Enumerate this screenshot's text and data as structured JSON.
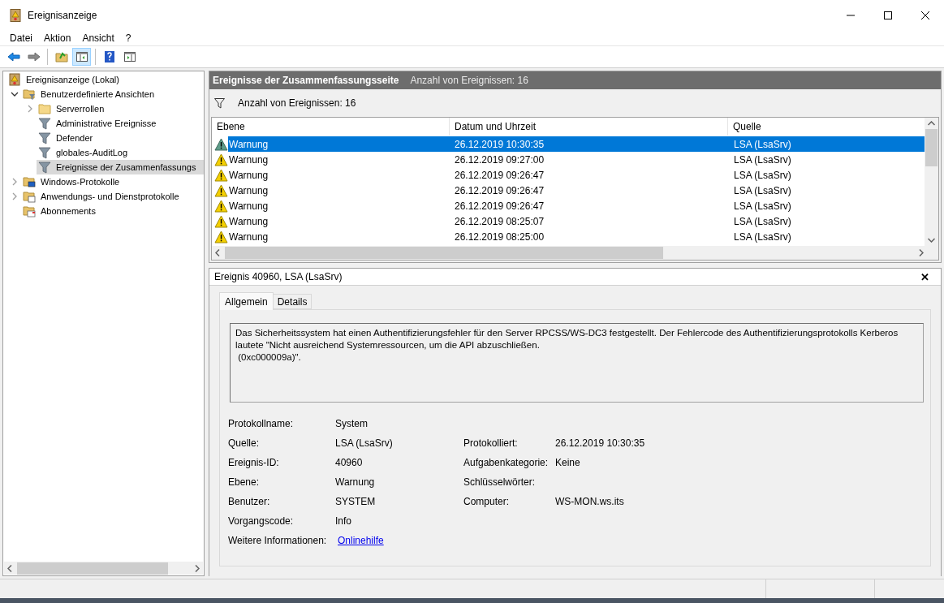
{
  "window": {
    "title": "Ereignisanzeige"
  },
  "menu": [
    "Datei",
    "Aktion",
    "Ansicht",
    "?"
  ],
  "toolbar": [
    {
      "kind": "back",
      "pressed": false
    },
    {
      "kind": "forward",
      "pressed": false
    },
    {
      "kind": "separator"
    },
    {
      "kind": "up-folder",
      "pressed": false
    },
    {
      "kind": "console-tree",
      "pressed": true
    },
    {
      "kind": "separator"
    },
    {
      "kind": "help",
      "pressed": false
    },
    {
      "kind": "action-pane",
      "pressed": false
    }
  ],
  "tree": [
    {
      "label": "Ereignisanzeige (Lokal)",
      "kind": "log",
      "selected": false,
      "children": [
        {
          "label": "Benutzerdefinierte Ansichten",
          "kind": "custom-folder",
          "expanded": true,
          "selected": false,
          "children": [
            {
              "label": "Serverrollen",
              "kind": "folder",
              "expanded": false,
              "selected": false
            },
            {
              "label": "Administrative Ereignisse",
              "kind": "filter",
              "selected": false
            },
            {
              "label": "Defender",
              "kind": "filter",
              "selected": false
            },
            {
              "label": "globales-AuditLog",
              "kind": "filter",
              "selected": false
            },
            {
              "label": "Ereignisse der Zusammenfassungs",
              "kind": "filter",
              "selected": true
            }
          ]
        },
        {
          "label": "Windows-Protokolle",
          "kind": "windows-folder",
          "expanded": false,
          "selected": false
        },
        {
          "label": "Anwendungs- und Dienstprotokolle",
          "kind": "app-folder",
          "expanded": false,
          "selected": false
        },
        {
          "label": "Abonnements",
          "kind": "subscriptions",
          "selected": false
        }
      ]
    }
  ],
  "header": {
    "title": "Ereignisse der Zusammenfassungsseite",
    "count": "Anzahl von Ereignissen: 16"
  },
  "filter_bar": {
    "text": "Anzahl von Ereignissen: 16"
  },
  "table": {
    "columns": [
      "Ebene",
      "Datum und Uhrzeit",
      "Quelle"
    ],
    "rows": [
      {
        "kind": "warning",
        "level": "Warnung",
        "date": "26.12.2019 10:30:35",
        "source": "LSA (LsaSrv)",
        "selected": true
      },
      {
        "kind": "warning",
        "level": "Warnung",
        "date": "26.12.2019 09:27:00",
        "source": "LSA (LsaSrv)",
        "selected": false
      },
      {
        "kind": "warning",
        "level": "Warnung",
        "date": "26.12.2019 09:26:47",
        "source": "LSA (LsaSrv)",
        "selected": false
      },
      {
        "kind": "warning",
        "level": "Warnung",
        "date": "26.12.2019 09:26:47",
        "source": "LSA (LsaSrv)",
        "selected": false
      },
      {
        "kind": "warning",
        "level": "Warnung",
        "date": "26.12.2019 09:26:47",
        "source": "LSA (LsaSrv)",
        "selected": false
      },
      {
        "kind": "warning",
        "level": "Warnung",
        "date": "26.12.2019 08:25:07",
        "source": "LSA (LsaSrv)",
        "selected": false
      },
      {
        "kind": "warning",
        "level": "Warnung",
        "date": "26.12.2019 08:25:00",
        "source": "LSA (LsaSrv)",
        "selected": false
      }
    ]
  },
  "detail": {
    "title": "Ereignis 40960, LSA (LsaSrv)",
    "close": "✕",
    "tabs": [
      {
        "label": "Allgemein",
        "selected": true
      },
      {
        "label": "Details",
        "selected": false
      }
    ],
    "description": "Das Sicherheitssystem hat einen Authentifizierungsfehler für den Server RPCSS/WS-DC3 festgestellt. Der Fehlercode des Authentifizierungsprotokolls Kerberos\nlautete \"Nicht ausreichend Systemressourcen, um die API abzuschließen.\n (0xc000009a)\".",
    "properties": [
      {
        "left": {
          "label": "Protokollname:",
          "value": "System"
        }
      },
      {
        "left": {
          "label": "Quelle:",
          "value": "LSA (LsaSrv)"
        },
        "right": {
          "label": "Protokolliert:",
          "value": "26.12.2019 10:30:35"
        }
      },
      {
        "left": {
          "label": "Ereignis-ID:",
          "value": "40960"
        },
        "right": {
          "label": "Aufgabenkategorie:",
          "value": "Keine"
        }
      },
      {
        "left": {
          "label": "Ebene:",
          "value": "Warnung"
        },
        "right": {
          "label": "Schlüsselwörter:"
        }
      },
      {
        "left": {
          "label": "Benutzer:",
          "value": "SYSTEM"
        },
        "right": {
          "label": "Computer:",
          "value": "WS-MON.ws.its"
        }
      },
      {
        "left": {
          "label": "Vorgangscode:",
          "value": "Info"
        }
      },
      {
        "left": {
          "label": "Weitere Informationen:",
          "value": "Onlinehilfe",
          "kind": "link"
        }
      }
    ]
  }
}
